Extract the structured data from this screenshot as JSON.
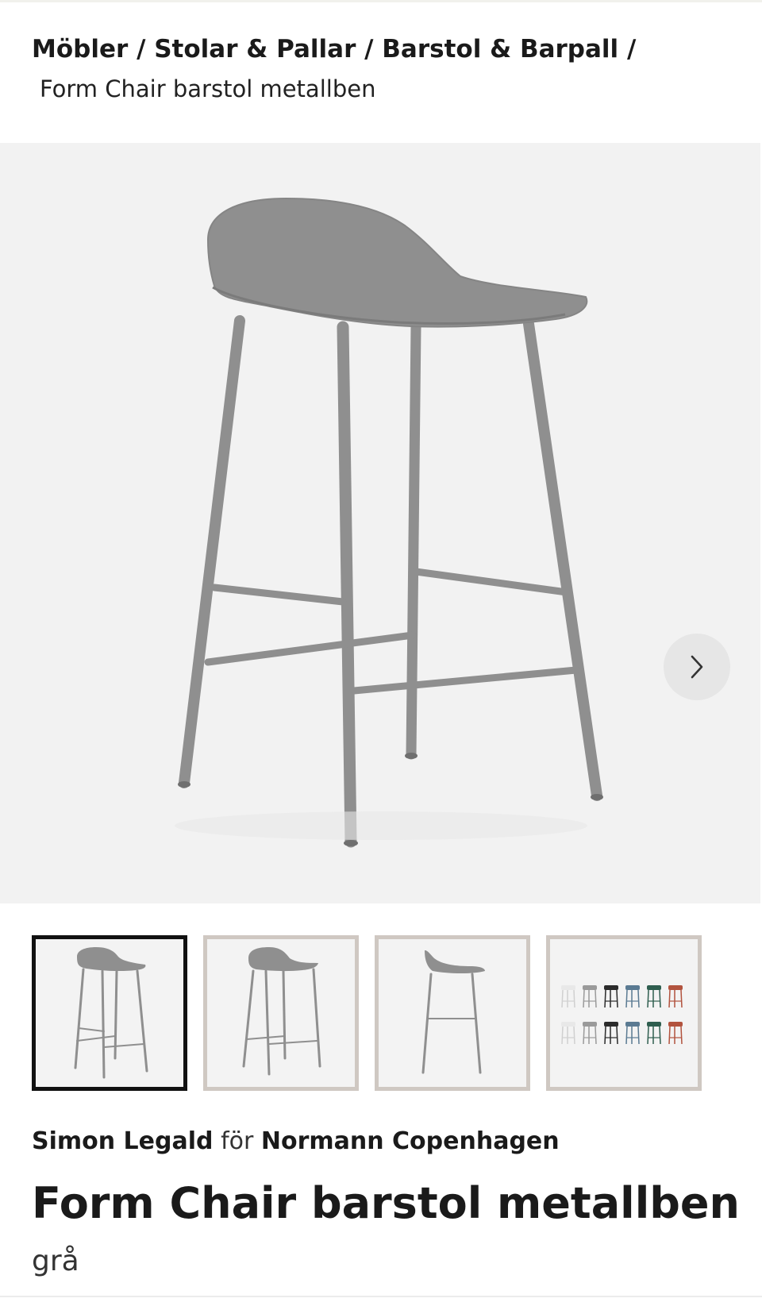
{
  "breadcrumb": {
    "items": [
      "Möbler",
      "Stolar & Pallar",
      "Barstol & Barpall"
    ],
    "separator": " / ",
    "trailing": " /",
    "current": "Form Chair barstol metallben"
  },
  "gallery": {
    "next_icon": "chevron-right-icon",
    "selected_index": 0,
    "thumbnail_count": 4,
    "product_color": "#8f8f8f",
    "background_color": "#f2f2f2",
    "swatch_colors": [
      "#e8e8e8",
      "#9a9a9a",
      "#2b2b2b",
      "#5a7a92",
      "#2f5e4f",
      "#b2533e"
    ]
  },
  "product": {
    "designer": "Simon Legald",
    "for_word": "för",
    "brand": "Normann Copenhagen",
    "title": "Form Chair barstol metallben",
    "variant": "grå"
  }
}
